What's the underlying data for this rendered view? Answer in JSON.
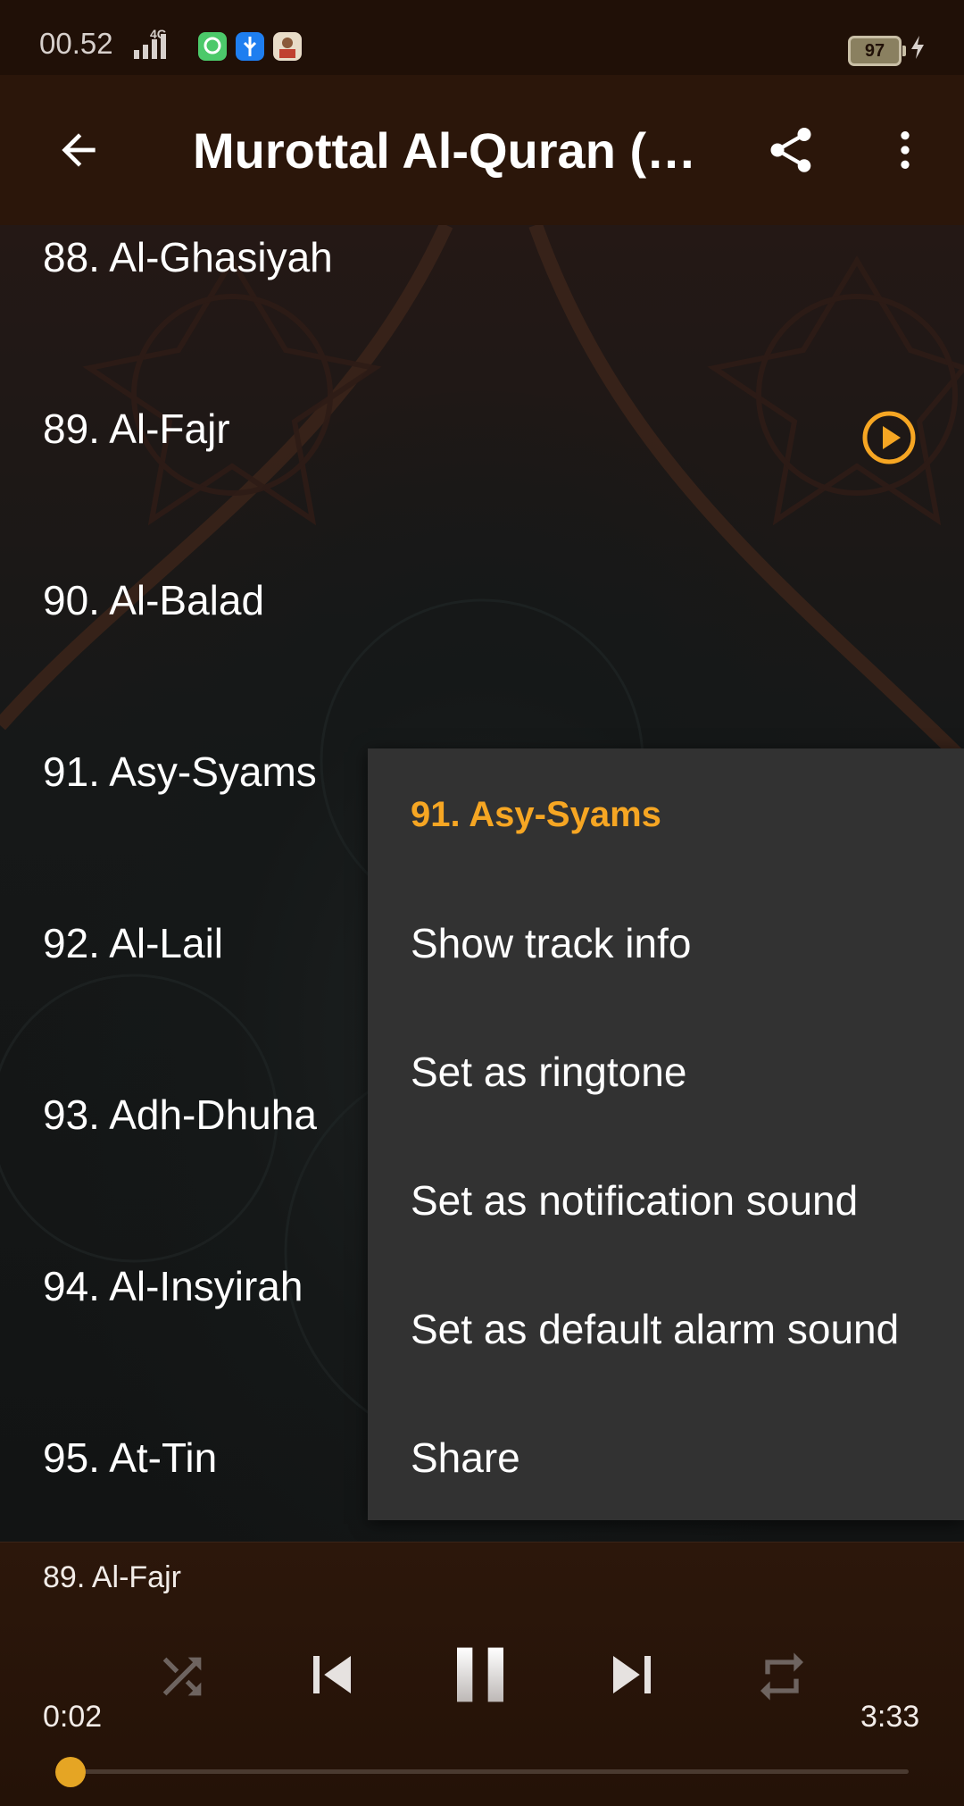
{
  "status_bar": {
    "time": "00.52",
    "network": "4G",
    "battery": "97"
  },
  "app_bar": {
    "title": "Murottal Al-Quran (…"
  },
  "surah_list": [
    {
      "label": "88. Al-Ghasiyah"
    },
    {
      "label": "89. Al-Fajr",
      "playing": true
    },
    {
      "label": "90. Al-Balad"
    },
    {
      "label": "91. Asy-Syams"
    },
    {
      "label": "92. Al-Lail"
    },
    {
      "label": "93. Adh-Dhuha"
    },
    {
      "label": "94. Al-Insyirah"
    },
    {
      "label": "95. At-Tin"
    }
  ],
  "context_menu": {
    "header": "91. Asy-Syams",
    "items": [
      "Show track info",
      "Set as ringtone",
      "Set as notification sound",
      "Set as default alarm sound",
      "Share"
    ]
  },
  "player": {
    "now_playing": "89. Al-Fajr",
    "elapsed": "0:02",
    "duration": "3:33",
    "progress_fraction": 0.01,
    "state": "playing"
  },
  "colors": {
    "accent": "#f6a623",
    "app_bar": "#2b160a",
    "menu_bg": "#323232",
    "status_bar": "#201007"
  },
  "icons": {
    "back": "arrow-left-icon",
    "share": "share-icon",
    "more": "more-vert-icon",
    "playing_indicator": "play-circle-icon",
    "shuffle": "shuffle-icon",
    "previous": "skip-previous-icon",
    "pause": "pause-icon",
    "next": "skip-next-icon",
    "repeat": "repeat-icon"
  }
}
